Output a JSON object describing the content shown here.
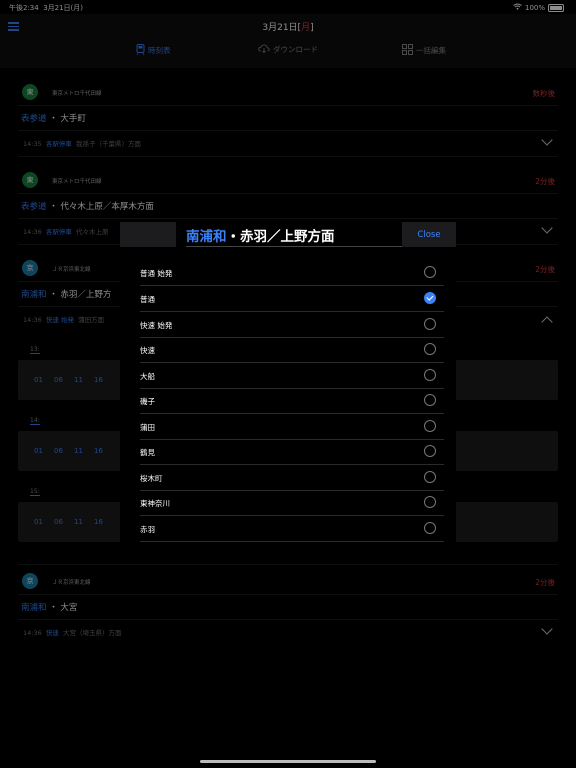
{
  "status": {
    "time": "午後2:34",
    "date": "3月21日(月)",
    "battery": "100%"
  },
  "header": {
    "title_prefix": "3月21日[",
    "title_day": "月",
    "title_suffix": "]"
  },
  "tabs": [
    {
      "label": "時刻表",
      "active": true
    },
    {
      "label": "ダウンロード",
      "active": false
    },
    {
      "label": "一括編集",
      "active": false
    }
  ],
  "cards": [
    {
      "badge": "東",
      "line": "東京メトロ千代田線",
      "until": "数秒後",
      "station": "表参道",
      "dest": "大手町",
      "time": "14:35",
      "type": "各駅停車",
      "direction": "我孫子（千葉県）方面"
    },
    {
      "badge": "東",
      "line": "東京メトロ千代田線",
      "until": "2分後",
      "station": "表参道",
      "dest": "代々木上原／本厚木方面",
      "time": "14:36",
      "type": "各駅停車",
      "direction": "代々木上原"
    },
    {
      "badge": "京",
      "line": "ＪＲ京浜東北線",
      "until": "2分後",
      "station": "南浦和",
      "dest": "赤羽／上野方",
      "time": "14:36",
      "type": "快速 始発",
      "direction": "蒲田方面"
    },
    {
      "badge": "京",
      "line": "ＪＲ京浜東北線",
      "until": "2分後",
      "station": "南浦和",
      "dest": "大宮",
      "time": "14:36",
      "type": "快速",
      "direction": "大宮（埼玉県）方面"
    }
  ],
  "timetable": [
    {
      "hour": "13:",
      "minutes": [
        "01",
        "06",
        "11",
        "16"
      ]
    },
    {
      "hour": "14:",
      "minutes": [
        "01",
        "06",
        "11",
        "16"
      ]
    },
    {
      "hour": "15:",
      "minutes": [
        "01",
        "06",
        "11",
        "16"
      ]
    }
  ],
  "modal": {
    "station": "南浦和",
    "dot": "・",
    "title_rest": "赤羽／上野方面",
    "close_label": "Close",
    "options": [
      {
        "label": "普通 始発",
        "checked": false
      },
      {
        "label": "普通",
        "checked": true
      },
      {
        "label": "快速 始発",
        "checked": false
      },
      {
        "label": "快速",
        "checked": false
      },
      {
        "label": "大船",
        "checked": false
      },
      {
        "label": "磯子",
        "checked": false
      },
      {
        "label": "蒲田",
        "checked": false
      },
      {
        "label": "鶴見",
        "checked": false
      },
      {
        "label": "桜木町",
        "checked": false
      },
      {
        "label": "東神奈川",
        "checked": false
      },
      {
        "label": "赤羽",
        "checked": false
      }
    ]
  },
  "colors": {
    "accent": "#3b82f6",
    "alert": "#e23b3b",
    "badge_green": "#17803f",
    "badge_cyan": "#1a7fa6"
  }
}
